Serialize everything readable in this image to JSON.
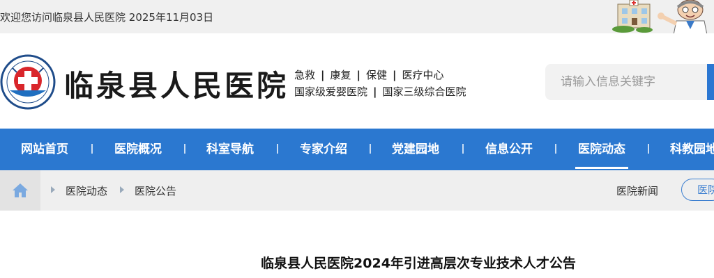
{
  "topbar": {
    "welcome": "欢迎您访问临泉县人民医院 2025年11月03日"
  },
  "header": {
    "site_name": "临泉县人民医院",
    "slogan_line1": [
      "急救",
      "康复",
      "保健",
      "医疗中心"
    ],
    "slogan_line2": [
      "国家级爱婴医院",
      "国家三级综合医院"
    ],
    "slogan_sep": "|"
  },
  "search": {
    "placeholder": "请输入信息关键字"
  },
  "nav": {
    "items": [
      "网站首页",
      "医院概况",
      "科室导航",
      "专家介绍",
      "党建园地",
      "信息公开",
      "医院动态",
      "科教园地"
    ],
    "active": "医院动态"
  },
  "breadcrumb": {
    "items": [
      "医院动态",
      "医院公告"
    ],
    "subnav": [
      "医院新闻",
      "医院公告"
    ]
  },
  "article": {
    "title": "临泉县人民医院2024年引进高层次专业技术人才公告"
  },
  "colors": {
    "brand_blue": "#2b78d0",
    "topbar_bg": "#f0f0f0",
    "crumb_bg": "#efefef"
  }
}
